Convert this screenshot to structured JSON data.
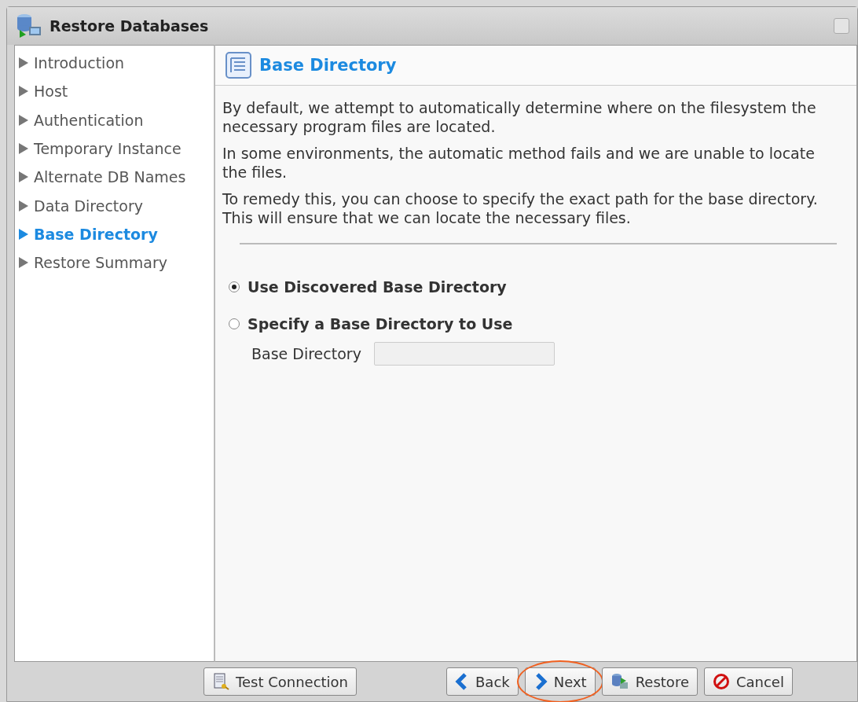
{
  "window": {
    "title": "Restore Databases"
  },
  "steps": [
    {
      "label": "Introduction",
      "selected": false
    },
    {
      "label": "Host",
      "selected": false
    },
    {
      "label": "Authentication",
      "selected": false
    },
    {
      "label": "Temporary Instance",
      "selected": false
    },
    {
      "label": "Alternate DB Names",
      "selected": false
    },
    {
      "label": "Data Directory",
      "selected": false
    },
    {
      "label": "Base Directory",
      "selected": true
    },
    {
      "label": "Restore Summary",
      "selected": false
    }
  ],
  "page": {
    "title": "Base Directory",
    "paragraphs": [
      "By default, we attempt to automatically determine where on the filesystem the necessary program files are located.",
      "In some environments, the automatic method fails and we are unable to locate the files.",
      "To remedy this, you can choose to specify the exact path for the base directory. This will ensure that we can locate the necessary files."
    ],
    "options": [
      {
        "label": "Use Discovered Base Directory",
        "selected": true
      },
      {
        "label": "Specify a Base Directory to Use",
        "selected": false
      }
    ],
    "field": {
      "label": "Base Directory",
      "disabled": true
    }
  },
  "buttons": [
    {
      "kind": "test",
      "label": "Test Connection",
      "highlighted": false
    },
    {
      "kind": "back",
      "label": "Back",
      "highlighted": false
    },
    {
      "kind": "next",
      "label": "Next",
      "highlighted": true
    },
    {
      "kind": "restore",
      "label": "Restore",
      "highlighted": false
    },
    {
      "kind": "cancel",
      "label": "Cancel",
      "highlighted": false
    }
  ]
}
